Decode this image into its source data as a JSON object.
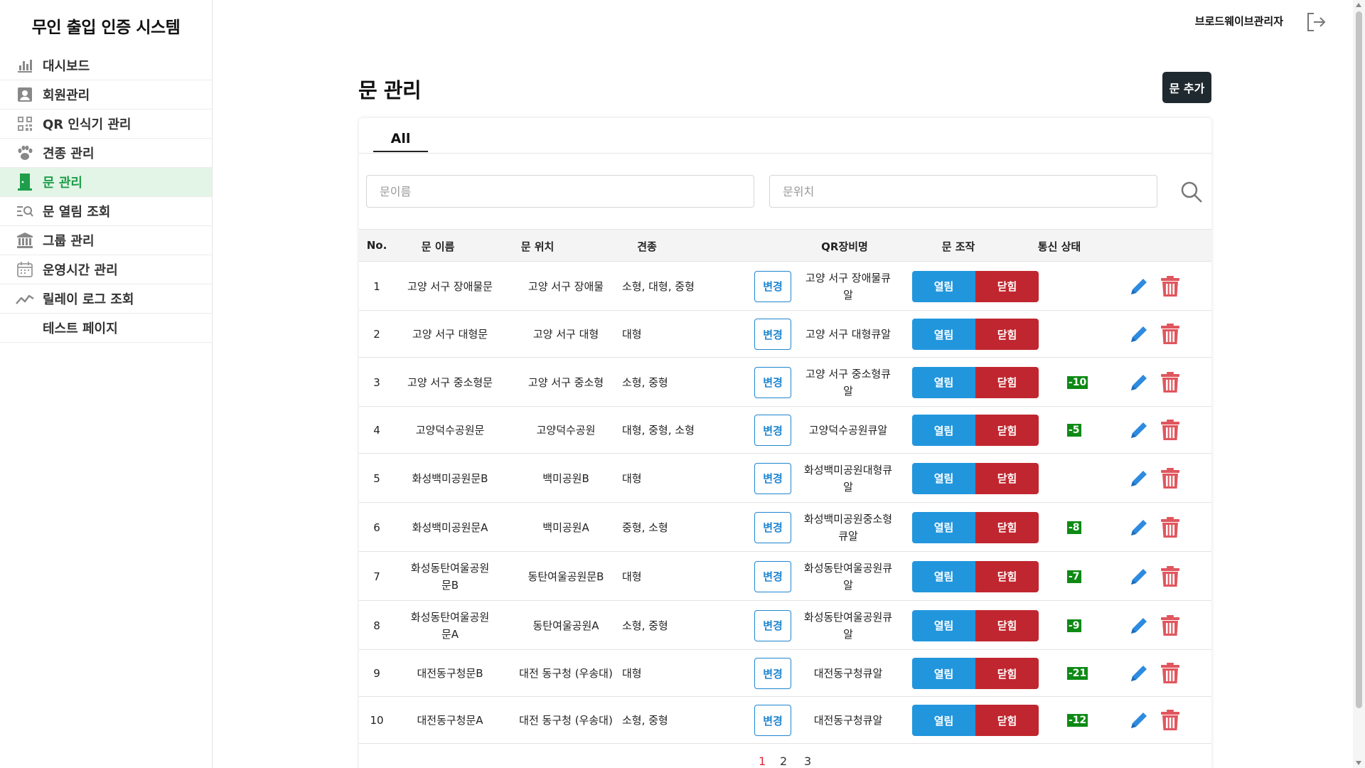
{
  "app": {
    "title": "무인 출입 인증 시스템",
    "user": "브로드웨이브관리자"
  },
  "sidebar": {
    "items": [
      {
        "label": "대시보드",
        "icon": "bar-chart-icon"
      },
      {
        "label": "회원관리",
        "icon": "user-card-icon"
      },
      {
        "label": "QR 인식기 관리",
        "icon": "qr-code-icon"
      },
      {
        "label": "견종 관리",
        "icon": "paw-icon"
      },
      {
        "label": "문 관리",
        "icon": "door-icon",
        "active": true
      },
      {
        "label": "문 열림 조회",
        "icon": "list-search-icon"
      },
      {
        "label": "그룹 관리",
        "icon": "building-icon"
      },
      {
        "label": "운영시간 관리",
        "icon": "calendar-icon"
      },
      {
        "label": "릴레이 로그 조회",
        "icon": "trend-line-icon"
      },
      {
        "label": "테스트 페이지",
        "icon": ""
      }
    ]
  },
  "page": {
    "title": "문 관리",
    "add_button": "문 추가"
  },
  "tabs": [
    "All"
  ],
  "search": {
    "name_placeholder": "문이름",
    "location_placeholder": "문위치"
  },
  "table": {
    "headers": {
      "no": "No.",
      "name": "문 이름",
      "location": "문 위치",
      "breed": "견종",
      "qr": "QR장비명",
      "control": "문 조작",
      "status": "통신 상태"
    },
    "change_label": "변경",
    "open_label": "열림",
    "close_label": "닫힘",
    "rows": [
      {
        "no": "1",
        "name": "고양 서구 장애물문",
        "location": "고양 서구 장애물",
        "breed": "소형, 대형, 중형",
        "qr": "고양 서구 장애물큐알",
        "status": ""
      },
      {
        "no": "2",
        "name": "고양 서구 대형문",
        "location": "고양 서구 대형",
        "breed": "대형",
        "qr": "고양 서구 대형큐알",
        "status": ""
      },
      {
        "no": "3",
        "name": "고양 서구 중소형문",
        "location": "고양 서구 중소형",
        "breed": "소형, 중형",
        "qr": "고양 서구 중소형큐알",
        "status": "-10"
      },
      {
        "no": "4",
        "name": "고양덕수공원문",
        "location": "고양덕수공원",
        "breed": "대형, 중형, 소형",
        "qr": "고양덕수공원큐알",
        "status": "-5"
      },
      {
        "no": "5",
        "name": "화성백미공원문B",
        "location": "백미공원B",
        "breed": "대형",
        "qr": "화성백미공원대형큐알",
        "status": ""
      },
      {
        "no": "6",
        "name": "화성백미공원문A",
        "location": "백미공원A",
        "breed": "중형, 소형",
        "qr": "화성백미공원중소형큐알",
        "status": "-8"
      },
      {
        "no": "7",
        "name": "화성동탄여울공원문B",
        "location": "동탄여울공원문B",
        "breed": "대형",
        "qr": "화성동탄여울공원큐알",
        "status": "-7"
      },
      {
        "no": "8",
        "name": "화성동탄여울공원문A",
        "location": "동탄여울공원A",
        "breed": "소형, 중형",
        "qr": "화성동탄여울공원큐알",
        "status": "-9"
      },
      {
        "no": "9",
        "name": "대전동구청문B",
        "location": "대전 동구청 (우송대)",
        "breed": "대형",
        "qr": "대전동구청큐알",
        "status": "-21"
      },
      {
        "no": "10",
        "name": "대전동구청문A",
        "location": "대전 동구청 (우송대)",
        "breed": "소형, 중형",
        "qr": "대전동구청큐알",
        "status": "-12"
      }
    ]
  },
  "pagination": {
    "pages": [
      "1",
      "2",
      "3"
    ],
    "current": "1"
  },
  "colors": {
    "accent_green": "#1e9e4a",
    "open_blue": "#2196dd",
    "close_red": "#c0262f",
    "status_green": "#0e8a15",
    "dark_button": "#1f2a30"
  }
}
